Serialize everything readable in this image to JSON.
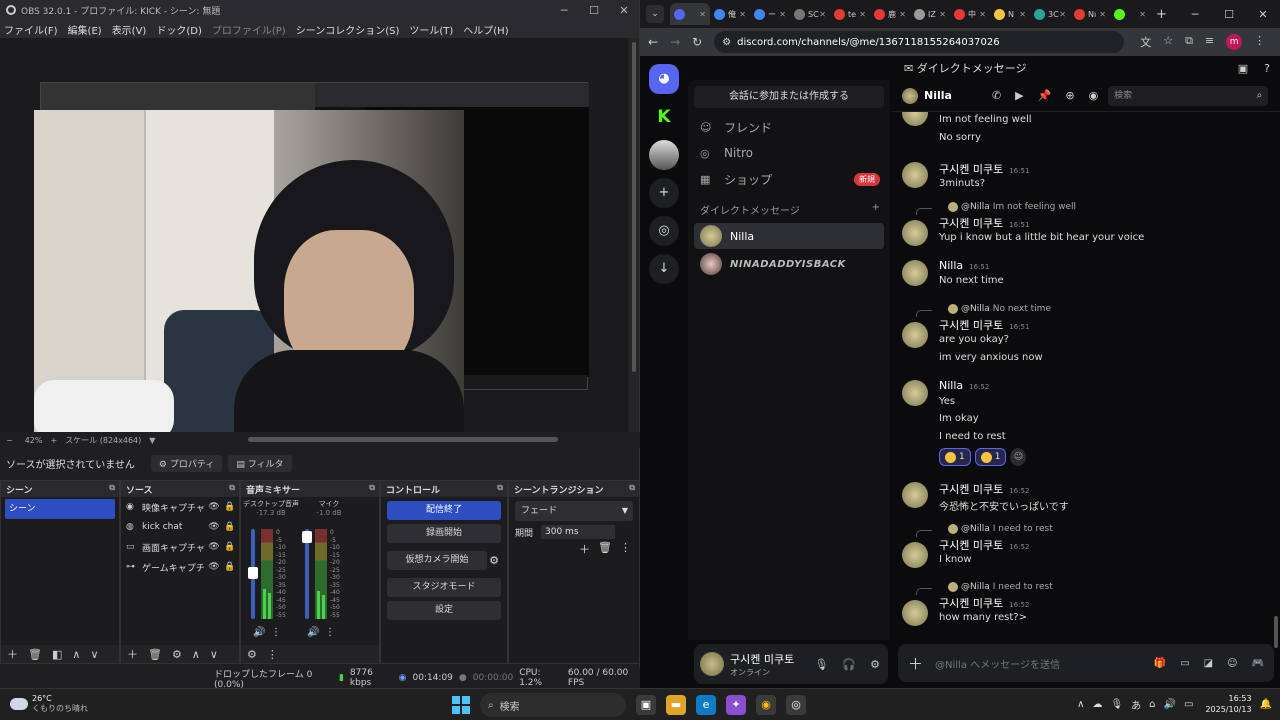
{
  "obs": {
    "title": "OBS 32.0.1 - プロファイル: KICK - シーン: 無題",
    "menus": [
      "ファイル(F)",
      "編集(E)",
      "表示(V)",
      "ドック(D)",
      "プロファイル(P)",
      "シーンコレクション(S)",
      "ツール(T)",
      "ヘルプ(H)"
    ],
    "zoom": "42%",
    "scale": "スケール (824x464)",
    "no_source": "ソースが選択されていません",
    "properties_btn": "プロパティ",
    "filters_btn": "フィルタ",
    "docks": {
      "scenes": "シーン",
      "sources": "ソース",
      "mixer": "音声ミキサー",
      "controls": "コントロール",
      "transitions": "シーントランジション"
    },
    "scene_items": [
      "シーン"
    ],
    "sources": [
      {
        "name": "映像キャプチャ",
        "icon": "camera-icon"
      },
      {
        "name": "kick chat",
        "icon": "globe-icon"
      },
      {
        "name": "画面キャプチャ",
        "icon": "monitor-icon"
      },
      {
        "name": "ゲームキャプチャ",
        "icon": "gamepad-icon"
      }
    ],
    "mixer": [
      {
        "name": "デスクトップ音声",
        "db": "-17.3 dB"
      },
      {
        "name": "マイク",
        "db": "-1.0 dB"
      }
    ],
    "meter_ticks": [
      "0",
      "-5",
      "-10",
      "-15",
      "-20",
      "-25",
      "-30",
      "-35",
      "-40",
      "-45",
      "-50",
      "-55",
      "-60"
    ],
    "controls": [
      "配信終了",
      "録画開始",
      "仮想カメラ開始",
      "スタジオモード",
      "設定"
    ],
    "transition": "フェード",
    "duration_label": "期間",
    "duration": "300 ms",
    "status": {
      "dropped": "ドロップしたフレーム 0 (0.0%)",
      "bitrate": "8776 kbps",
      "live_time": "00:14:09",
      "rec_time": "00:00:00",
      "cpu": "CPU: 1.2%",
      "fps": "60.00 / 60.00 FPS"
    }
  },
  "chrome": {
    "tabs": [
      {
        "label": "",
        "color": "#5865f2",
        "active": true
      },
      {
        "label": "俺",
        "color": "#4285f4"
      },
      {
        "label": "ー",
        "color": "#4285f4"
      },
      {
        "label": "SC",
        "color": "#777777"
      },
      {
        "label": "te",
        "color": "#e53935"
      },
      {
        "label": "鹿",
        "color": "#e53935"
      },
      {
        "label": "IZ",
        "color": "#999999"
      },
      {
        "label": "中",
        "color": "#e53935"
      },
      {
        "label": "N",
        "color": "#f5c542"
      },
      {
        "label": "3C",
        "color": "#26a69a"
      },
      {
        "label": "Nı",
        "color": "#e53935"
      },
      {
        "label": "",
        "color": "#53fc18"
      }
    ],
    "url": "discord.com/channels/@me/1367118155264037026",
    "profile_initial": "m"
  },
  "discord": {
    "top_title": "ダイレクトメッセージ",
    "search_dm": "会話に参加または作成する",
    "nav": [
      {
        "label": "フレンド",
        "icon": "friends-icon"
      },
      {
        "label": "Nitro",
        "icon": "nitro-icon"
      },
      {
        "label": "ショップ",
        "icon": "shop-icon",
        "badge": "新規"
      }
    ],
    "dm_header": "ダイレクトメッセージ",
    "dms": [
      {
        "name": "Nilla",
        "selected": true
      },
      {
        "name": "NINADADDYISBACK",
        "selected": false
      }
    ],
    "user": {
      "name": "구시켄 미쿠토",
      "status": "オンライン"
    },
    "chat_name": "Nilla",
    "chat_search": "検索",
    "composer_placeholder": "@Nilla へメッセージを送信",
    "messages": [
      {
        "lines": [
          "Im not feeling well",
          "No sorry"
        ]
      },
      {
        "author": "구시켄 미쿠토",
        "time": "16:51",
        "lines": [
          "3minuts?"
        ]
      },
      {
        "reply_to": "@Nilla",
        "reply_text": "Im not feeling well",
        "author": "구시켄 미쿠토",
        "time": "16:51",
        "lines": [
          "Yup i know but a little bit hear your voice"
        ]
      },
      {
        "author": "Nilla",
        "time": "16:51",
        "lines": [
          "No next time"
        ]
      },
      {
        "reply_to": "@Nilla",
        "reply_text": "No next time",
        "author": "구시켄 미쿠토",
        "time": "16:51",
        "lines": [
          "are you okay?",
          "im very anxious now"
        ]
      },
      {
        "author": "Nilla",
        "time": "16:52",
        "lines": [
          "Yes",
          "Im okay",
          "I need to rest"
        ],
        "reactions": [
          "1",
          "1"
        ]
      },
      {
        "author": "구시켄 미쿠토",
        "time": "16:52",
        "lines": [
          "今恐怖と不安でいっぱいです"
        ]
      },
      {
        "reply_to": "@Nilla",
        "reply_text": "I need to rest",
        "author": "구시켄 미쿠토",
        "time": "16:52",
        "lines": [
          "I know"
        ]
      },
      {
        "reply_to": "@Nilla",
        "reply_text": "I need to rest",
        "author": "구시켄 미쿠토",
        "time": "16:52",
        "lines": [
          "how many rest?>"
        ]
      }
    ]
  },
  "taskbar": {
    "temp": "26°C",
    "weather": "くもりのち晴れ",
    "search": "検索",
    "ime": "あ",
    "time": "16:53",
    "date": "2025/10/13"
  }
}
